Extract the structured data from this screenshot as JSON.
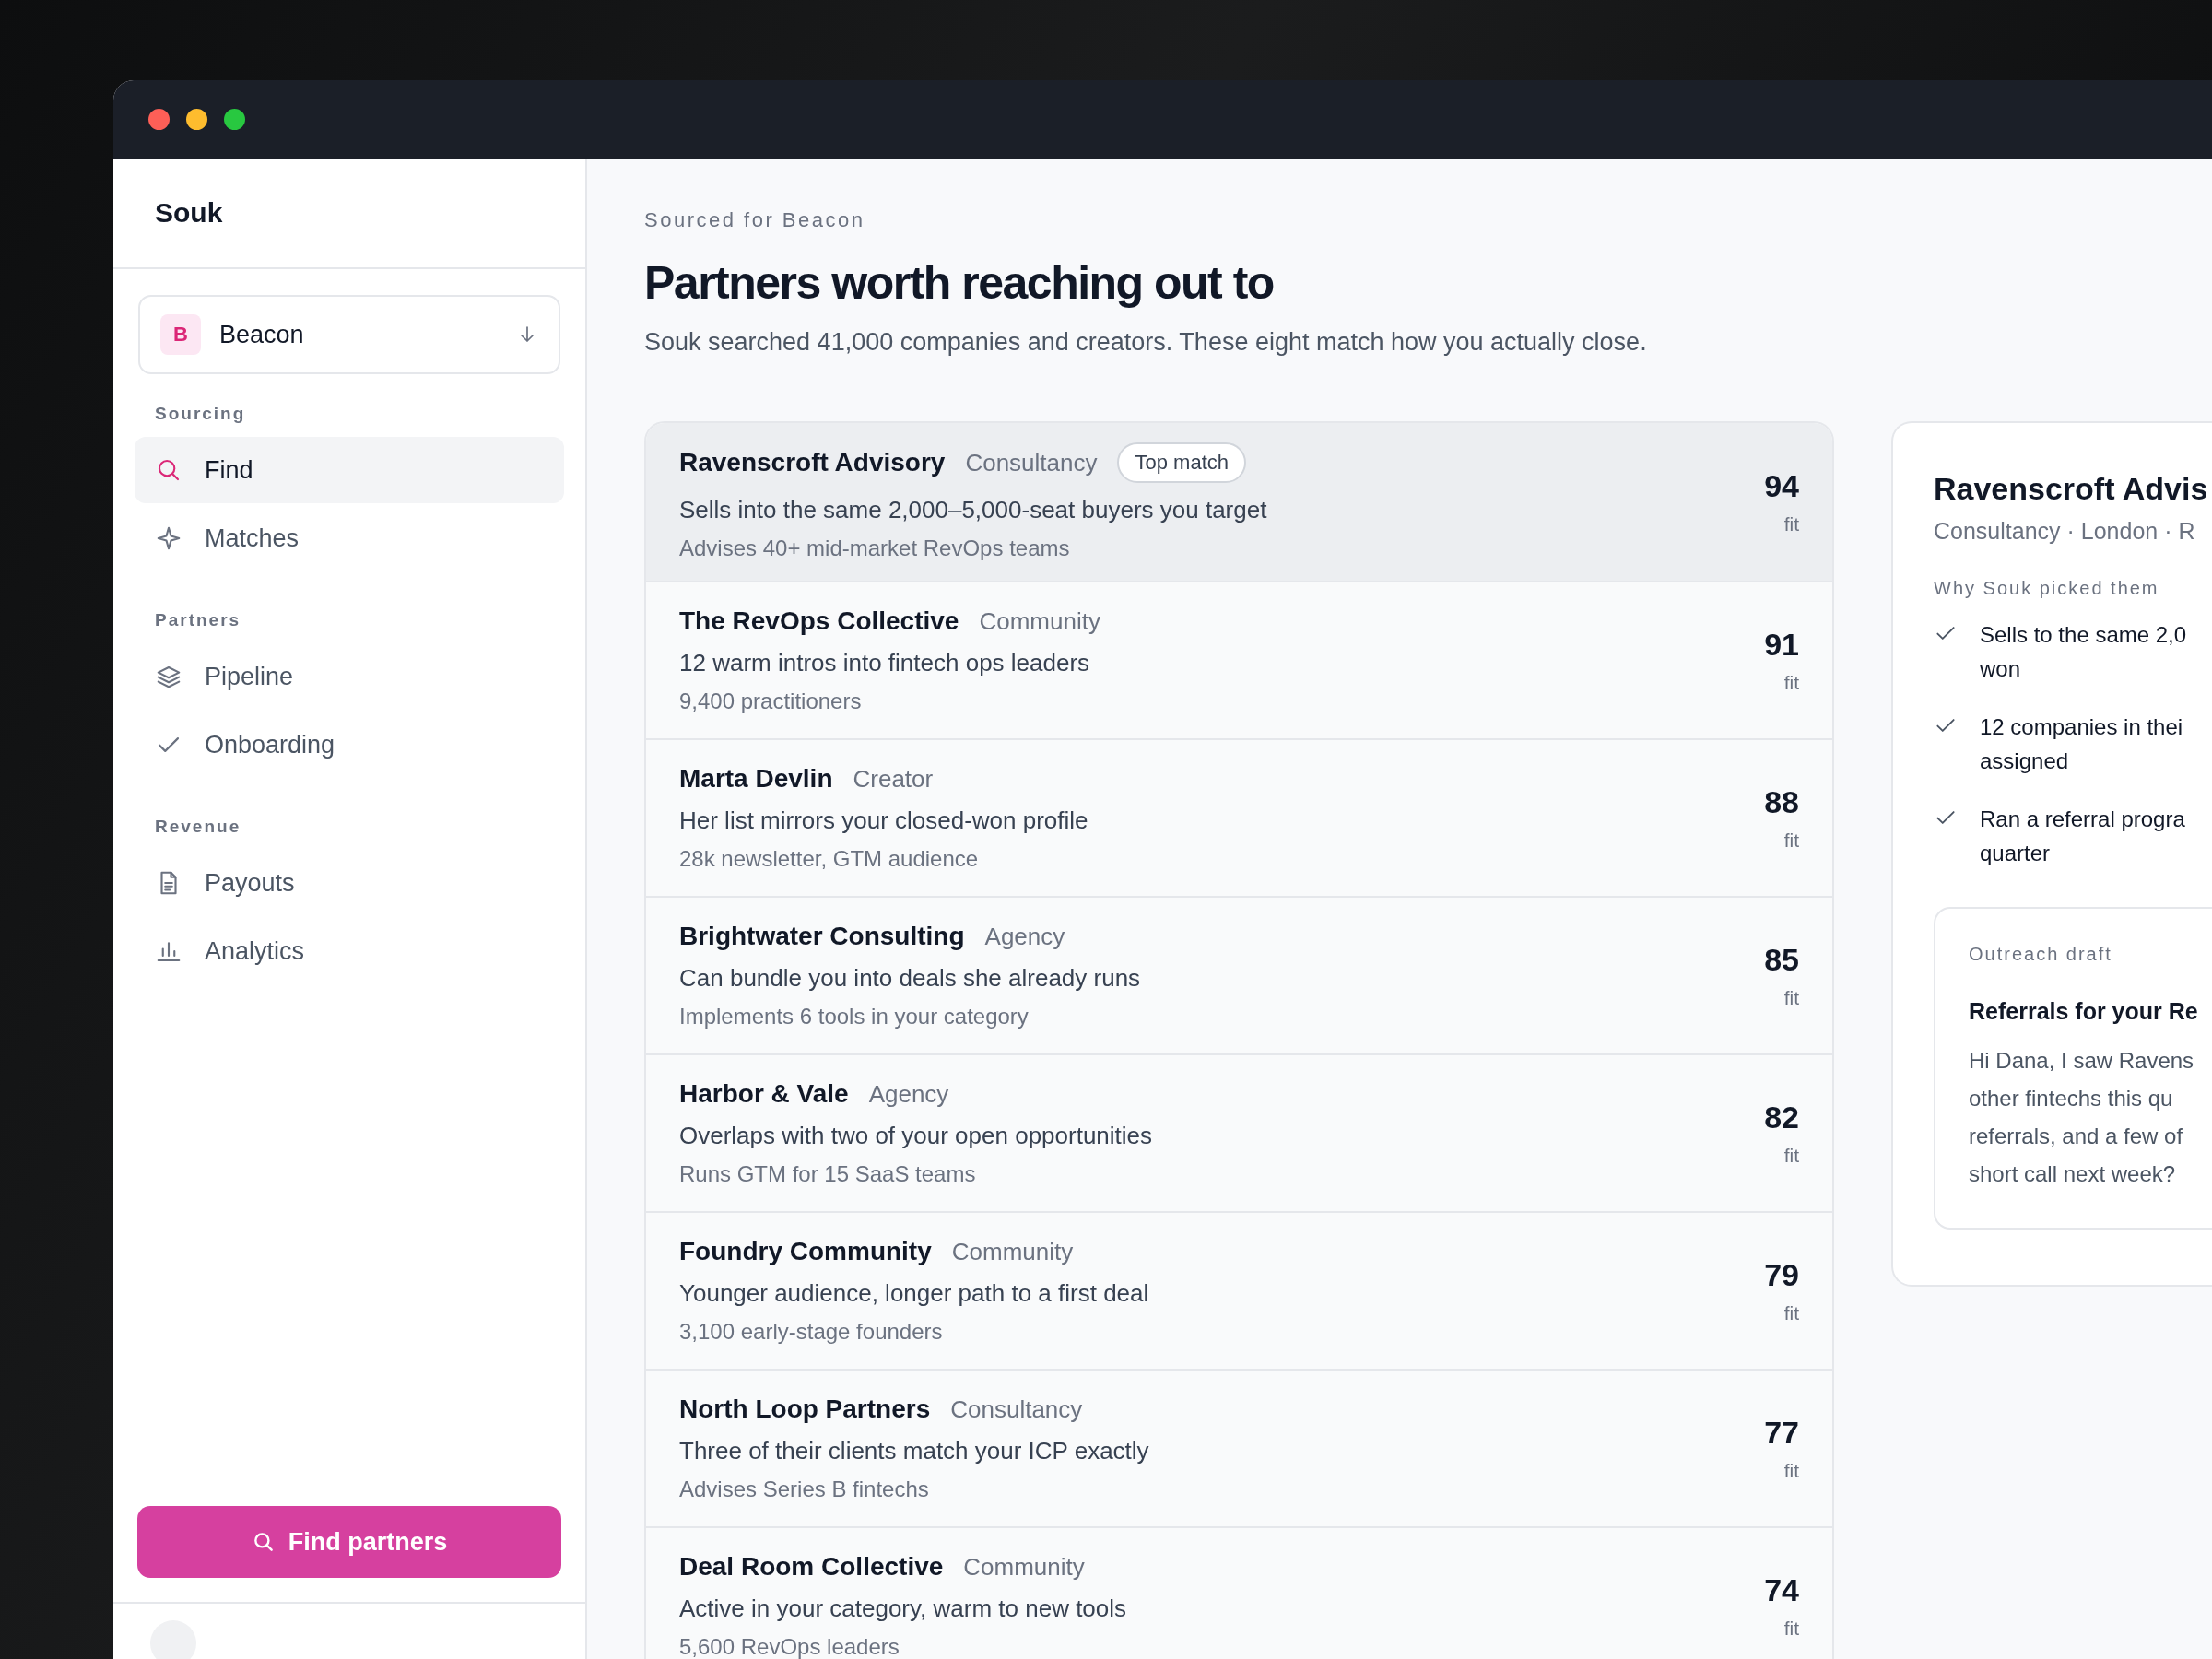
{
  "app": {
    "brand": "Souk"
  },
  "workspace": {
    "initial": "B",
    "name": "Beacon"
  },
  "sidebar": {
    "sections": [
      {
        "label": "Sourcing",
        "items": [
          {
            "label": "Find",
            "selected": true
          },
          {
            "label": "Matches",
            "selected": false
          }
        ]
      },
      {
        "label": "Partners",
        "items": [
          {
            "label": "Pipeline",
            "selected": false
          },
          {
            "label": "Onboarding",
            "selected": false
          }
        ]
      },
      {
        "label": "Revenue",
        "items": [
          {
            "label": "Payouts",
            "selected": false
          },
          {
            "label": "Analytics",
            "selected": false
          }
        ]
      }
    ],
    "action": "Find partners"
  },
  "header": {
    "eyebrow": "Sourced for Beacon",
    "title": "Partners worth reaching out to",
    "subtitle": "Souk searched 41,000 companies and creators. These eight match how you actually close."
  },
  "partners": [
    {
      "name": "Ravenscroft Advisory",
      "type": "Consultancy",
      "badge": "Top match",
      "reason": "Sells into the same 2,000–5,000-seat buyers you target",
      "meta": "Advises 40+ mid-market RevOps teams",
      "score": "94",
      "unit": "fit",
      "selected": true
    },
    {
      "name": "The RevOps Collective",
      "type": "Community",
      "reason": "12 warm intros into fintech ops leaders",
      "meta": "9,400 practitioners",
      "score": "91",
      "unit": "fit",
      "selected": false
    },
    {
      "name": "Marta Devlin",
      "type": "Creator",
      "reason": "Her list mirrors your closed-won profile",
      "meta": "28k newsletter, GTM audience",
      "score": "88",
      "unit": "fit",
      "selected": false
    },
    {
      "name": "Brightwater Consulting",
      "type": "Agency",
      "reason": "Can bundle you into deals she already runs",
      "meta": "Implements 6 tools in your category",
      "score": "85",
      "unit": "fit",
      "selected": false
    },
    {
      "name": "Harbor & Vale",
      "type": "Agency",
      "reason": "Overlaps with two of your open opportunities",
      "meta": "Runs GTM for 15 SaaS teams",
      "score": "82",
      "unit": "fit",
      "selected": false
    },
    {
      "name": "Foundry Community",
      "type": "Community",
      "reason": "Younger audience, longer path to a first deal",
      "meta": "3,100 early-stage founders",
      "score": "79",
      "unit": "fit",
      "selected": false
    },
    {
      "name": "North Loop Partners",
      "type": "Consultancy",
      "reason": "Three of their clients match your ICP exactly",
      "meta": "Advises Series B fintechs",
      "score": "77",
      "unit": "fit",
      "selected": false
    },
    {
      "name": "Deal Room Collective",
      "type": "Community",
      "reason": "Active in your category, warm to new tools",
      "meta": "5,600 RevOps leaders",
      "score": "74",
      "unit": "fit",
      "selected": false
    }
  ],
  "detail": {
    "title": "Ravenscroft Advis",
    "subtitle": "Consultancy · London · R",
    "why_label": "Why Souk picked them",
    "reasons": [
      [
        "Sells to the same 2,0",
        "won"
      ],
      [
        "12 companies in thei",
        "assigned"
      ],
      [
        "Ran a referral progra",
        "quarter"
      ]
    ],
    "draft": {
      "label": "Outreach draft",
      "subject": "Referrals for your Re",
      "body": [
        "Hi Dana, I saw Ravens",
        "other fintechs this qu",
        "referrals, and a few of",
        "short call next week?"
      ]
    }
  }
}
